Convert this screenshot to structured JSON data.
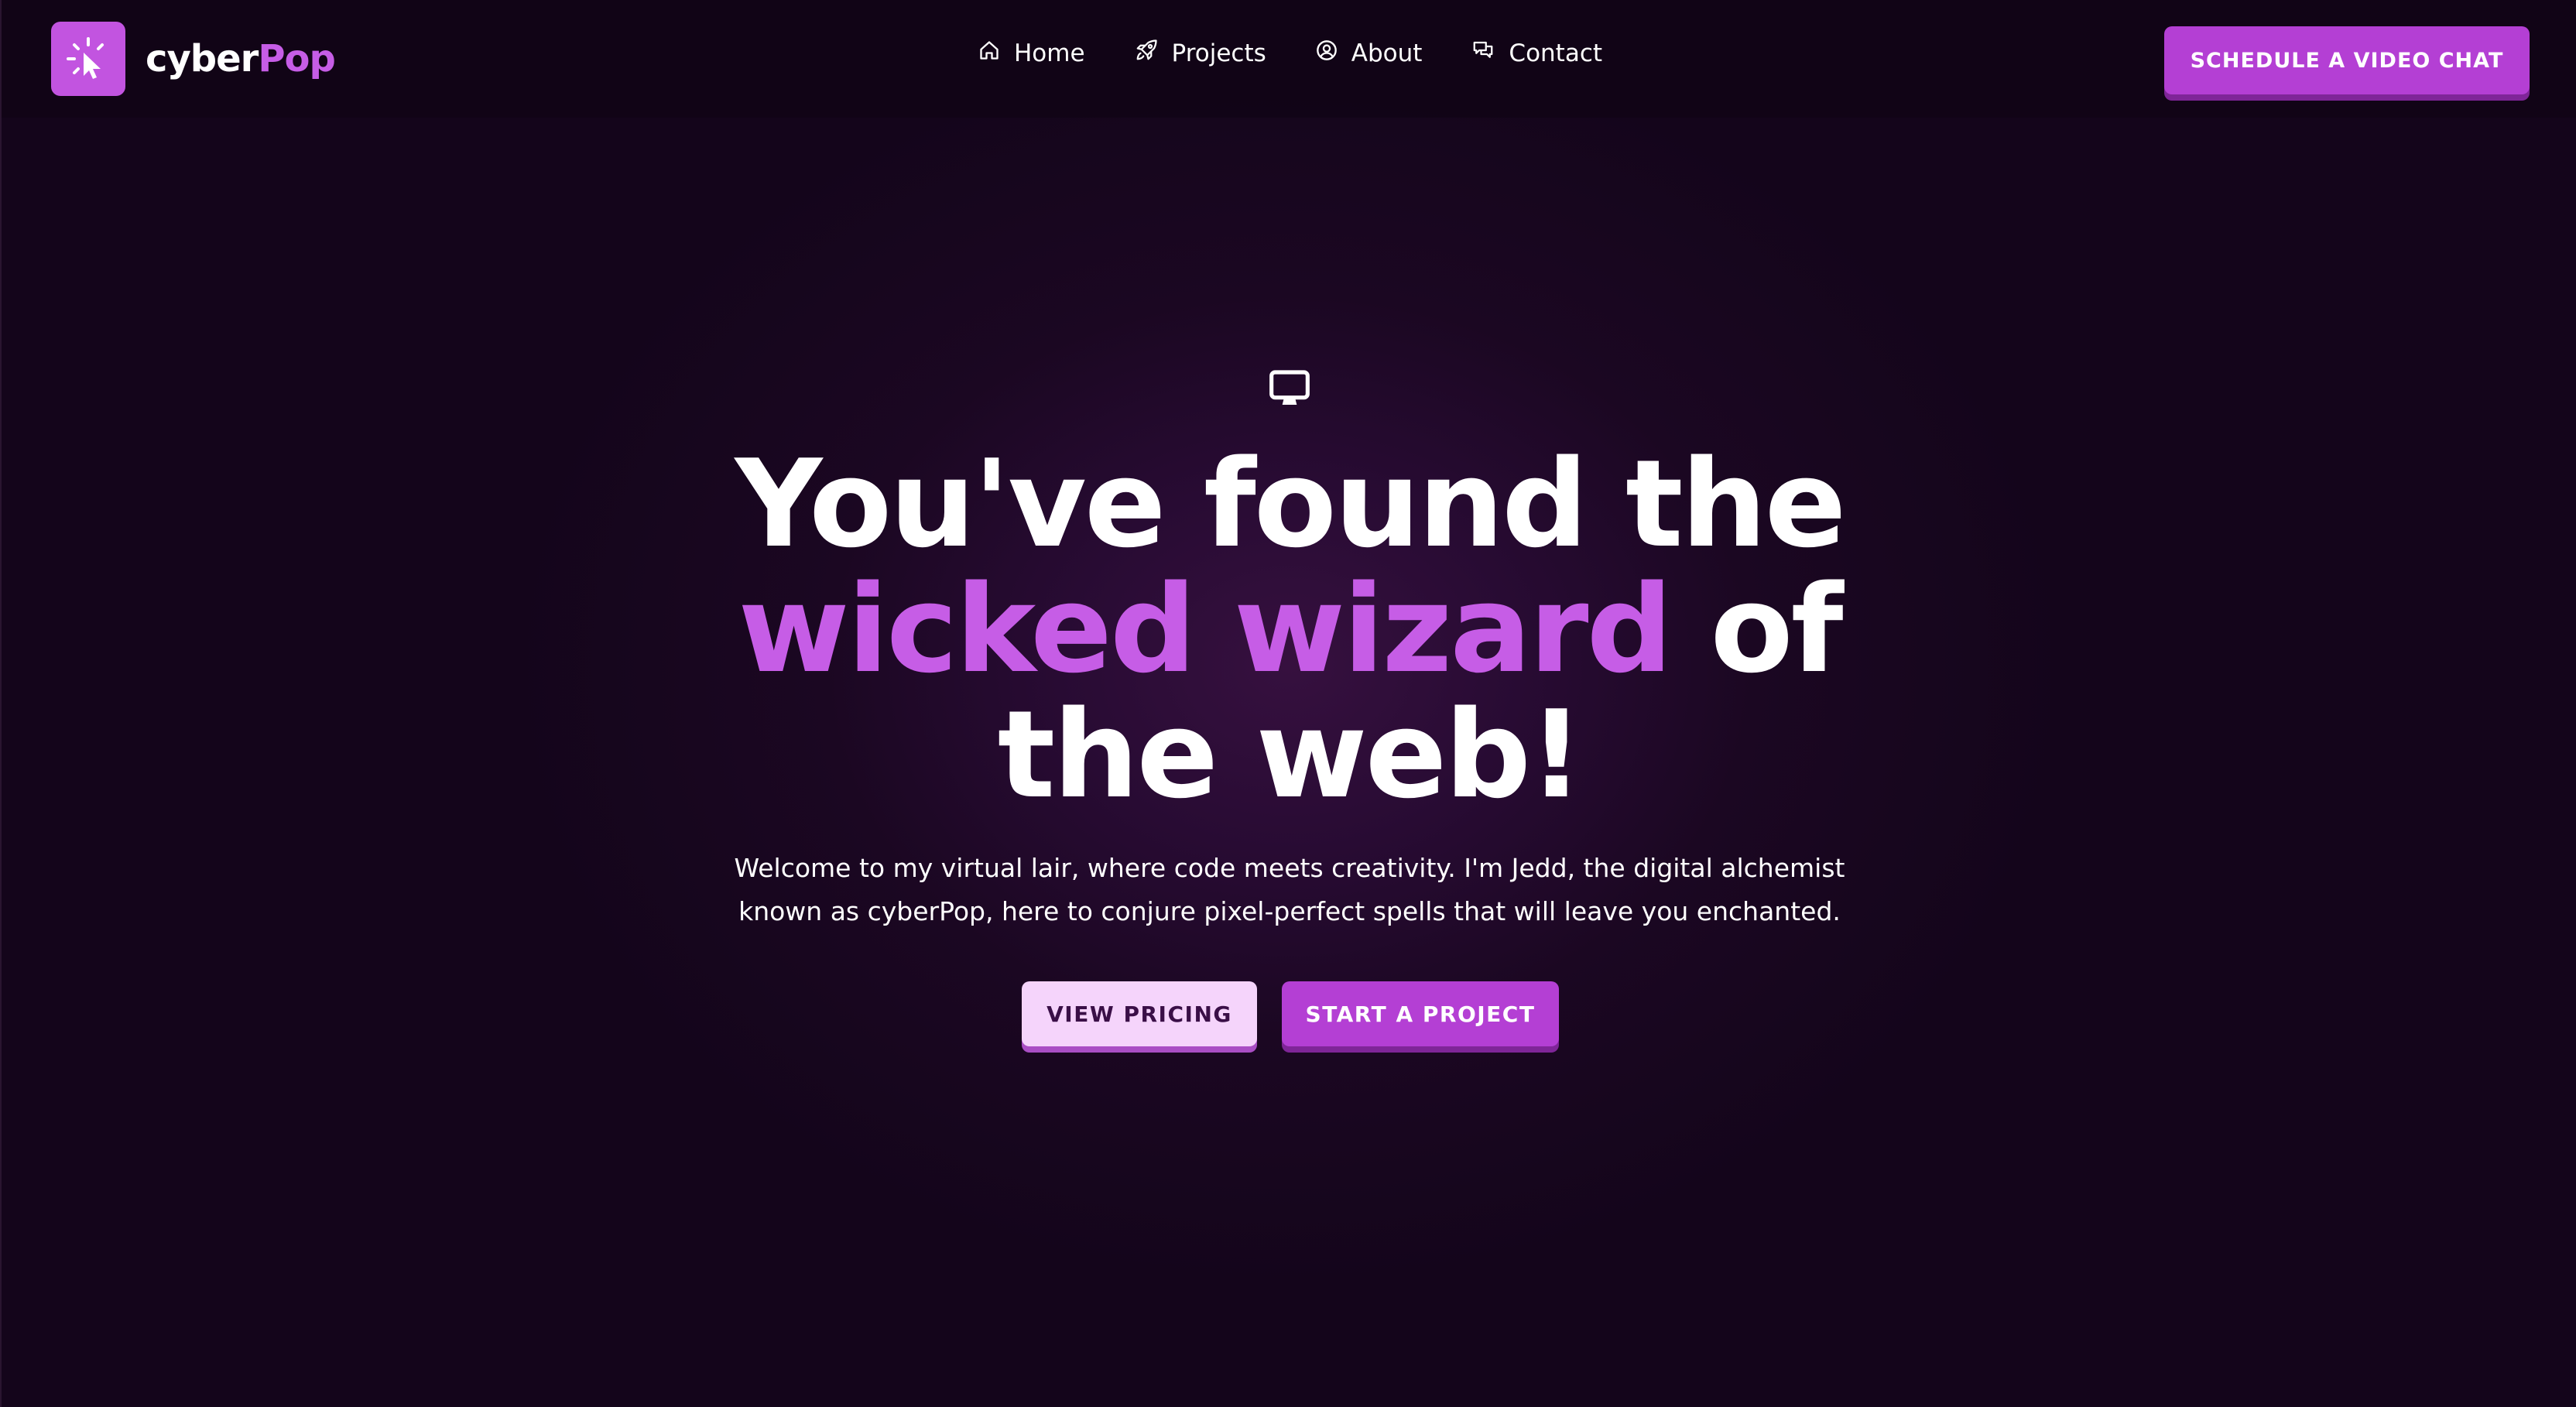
{
  "brand": {
    "name_part1": "cyber",
    "name_part2": "Pop",
    "logo_icon": "cursor-click-icon",
    "accent_color": "#c65de6"
  },
  "nav": {
    "items": [
      {
        "label": "Home",
        "icon": "home-icon"
      },
      {
        "label": "Projects",
        "icon": "rocket-icon"
      },
      {
        "label": "About",
        "icon": "user-circle-icon"
      },
      {
        "label": "Contact",
        "icon": "chat-icon"
      }
    ],
    "cta_label": "SCHEDULE A VIDEO CHAT"
  },
  "hero": {
    "icon": "monitor-icon",
    "headline_part1": "You've found the",
    "headline_highlight": "wicked wizard",
    "headline_part2": "of",
    "headline_part3": "the web!",
    "subtext_line1": "Welcome to my virtual lair, where code meets creativity. I'm Jedd, the digital alchemist",
    "subtext_line2": "known as cyberPop, here to conjure pixel-perfect spells that will leave you enchanted.",
    "primary_button": "VIEW PRICING",
    "secondary_button": "START A PROJECT"
  },
  "colors": {
    "background": "#1b0722",
    "button_purple": "#b43fd4",
    "button_light": "#f5d4fb"
  }
}
